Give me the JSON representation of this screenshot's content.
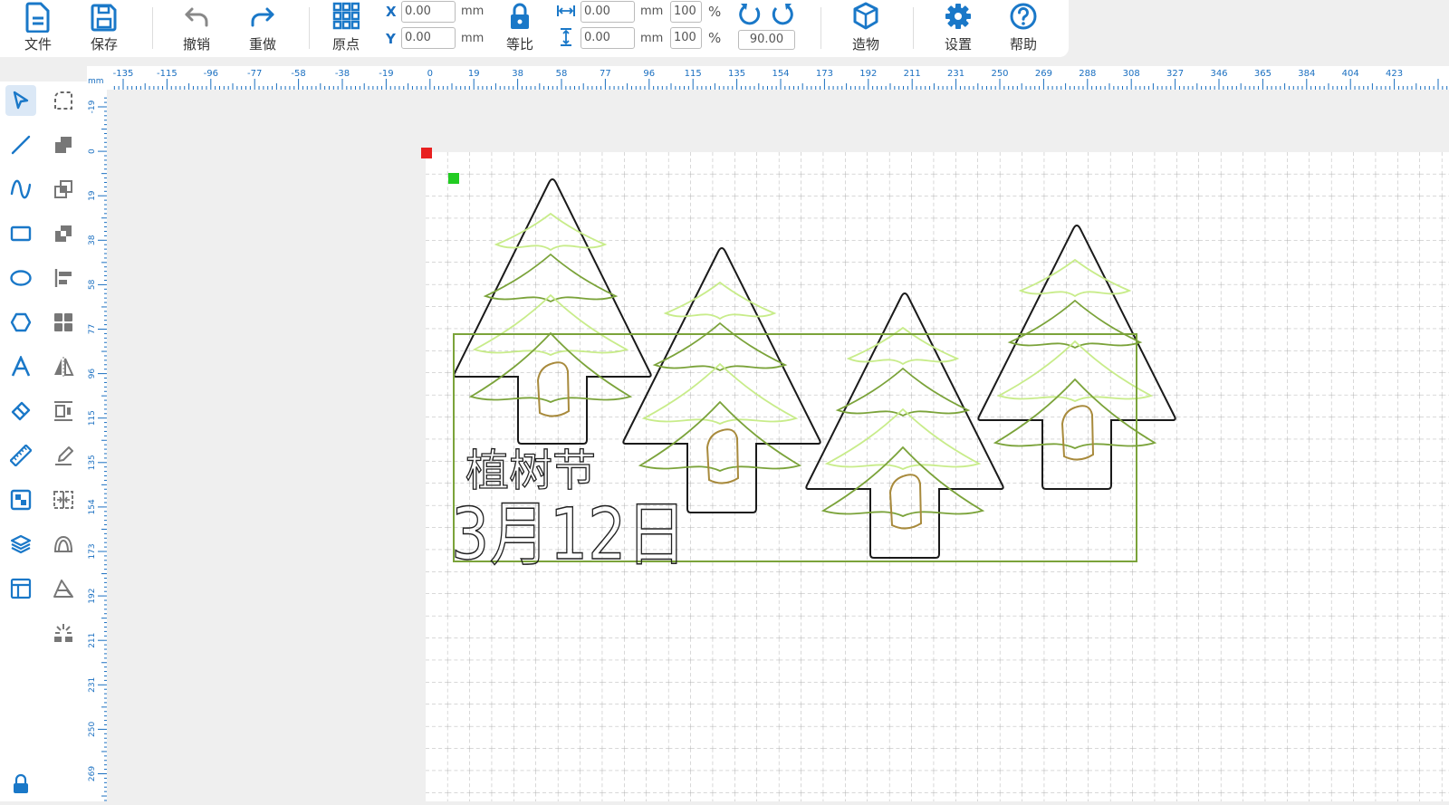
{
  "toolbar": {
    "file": "文件",
    "save": "保存",
    "undo": "撤销",
    "redo": "重做",
    "origin": "原点",
    "proportional": "等比",
    "build": "造物",
    "settings": "设置",
    "help": "帮助",
    "x_label": "X",
    "y_label": "Y",
    "x_value": "0.00",
    "y_value": "0.00",
    "mm": "mm",
    "width_value": "0.00",
    "height_value": "0.00",
    "width_percent": "100",
    "height_percent": "100",
    "percent": "%",
    "rotate_angle": "90.00"
  },
  "ruler": {
    "unit": "mm",
    "top_labels": [
      "-135",
      "-115",
      "-96",
      "-77",
      "-58",
      "-38",
      "-19",
      "0",
      "19",
      "38",
      "58",
      "77",
      "96",
      "115",
      "135",
      "154",
      "173",
      "192",
      "211",
      "231",
      "250",
      "269",
      "288",
      "308",
      "327",
      "346",
      "365",
      "384",
      "404",
      "423"
    ],
    "left_labels": [
      "-19",
      "0",
      "19",
      "38",
      "58",
      "77",
      "96",
      "115",
      "135",
      "154",
      "173",
      "192",
      "211",
      "231",
      "250",
      "269"
    ]
  },
  "design": {
    "title_text": "植树节",
    "date_text": "3月12日"
  },
  "colors": {
    "accent": "#1a78c8",
    "tree_dark": "#7ba33a",
    "tree_light": "#c8ec8a",
    "trunk": "#a88a3c",
    "selection": "#7ba33a",
    "marker_red": "#e82020",
    "marker_green": "#22cc22"
  }
}
